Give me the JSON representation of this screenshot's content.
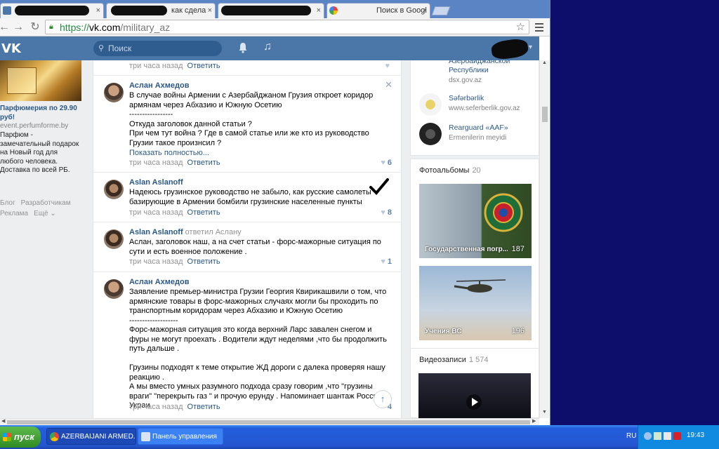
{
  "browser": {
    "tabs": [
      {
        "title": "",
        "redacted": true
      },
      {
        "title": "как сдела",
        "redacted": true
      },
      {
        "title": "",
        "redacted": true
      },
      {
        "title": "Поиск в Googl",
        "redacted": false
      }
    ],
    "url": {
      "scheme": "https://",
      "host": "vk.com",
      "path": "/military_az"
    }
  },
  "vk": {
    "logo": "VK",
    "search_placeholder": "Поиск"
  },
  "ad": {
    "title": "Парфюмерия по 29.90 руб!",
    "domain": "event.perfumforme.by",
    "text": "Парфюм - замечательный подарок на Новый год для любого человека. Доставка по всей РБ."
  },
  "footer_links": [
    "Блог",
    "Разработчикам",
    "Реклама",
    "Ещё ⌄"
  ],
  "feed": {
    "top_meta": {
      "time": "три часа назад",
      "reply": "Ответить"
    },
    "posts": [
      {
        "author": "Аслан Ахмедов",
        "author_extra": "",
        "text": "В случае войны Армении с Азербайджаном Грузия откроет коридор армянам через Абхазию и Южную Осетию\n-----------------\nОткуда заголовок данной статьи ?\nПри чем тут война ? Где в самой статье или же кто из руководство Грузии такое произнсил ?",
        "more": "Показать полностью...",
        "time": "три часа назад",
        "reply": "Ответить",
        "likes": "6"
      },
      {
        "author": "Aslan Aslanoff",
        "author_extra": "",
        "text": "Надеюсь грузинское руководство не забыло, как русские самолеты базирующие в Армении бомбили грузинские населенные пункты",
        "more": "",
        "time": "три часа назад",
        "reply": "Ответить",
        "likes": "8"
      },
      {
        "author": "Aslan Aslanoff",
        "author_extra": "ответил Аслану",
        "text": "Аслан, заголовок наш, а на счет статьи - форс-мажорные ситуация по сути и есть военное положение .",
        "more": "",
        "time": "три часа назад",
        "reply": "Ответить",
        "likes": "1"
      },
      {
        "author": "Аслан Ахмедов",
        "author_extra": "",
        "text": "Заявление премьер-министра Грузии Георгия Квирикашвили о том, что армянские товары в форс-мажорных случаях могли бы проходить по транспортным коридорам через Абхазию и Южную Осетию\n-------------------\nФорс-мажорная ситуация это когда верхний Ларс завален снегом и фуры не могут проехать . Водители ждут неделями ,что бы продолжить путь дальше .\n\nГрузины подходят к теме открытие ЖД дороги с далека проверяя нашу реакцию .\nА мы вместо умных разумного подхода сразу говорим ,что \"грузины враги\" \"перекрыть газ \" и прочую ерунду . Напоминает шантаж Россией Украи",
        "more": "",
        "time": "три часа назад",
        "reply": "Ответить",
        "likes": "4"
      }
    ]
  },
  "links": [
    {
      "title": "Азербайджанской Республики",
      "title_top": "...Азербайджанской",
      "sub": "dsx.gov.az"
    },
    {
      "title": "Səfərbərlik",
      "sub": "www.seferberlik.gov.az"
    },
    {
      "title": "Rearguard «AAF»",
      "sub": "Ermenilerin meyidi"
    }
  ],
  "photo_albums": {
    "title": "Фотоальбомы",
    "count": "20",
    "items": [
      {
        "label": "Государственная погр...",
        "count": "187"
      },
      {
        "label": "Учения ВС",
        "count": "196"
      }
    ]
  },
  "videos": {
    "title": "Видеозаписи",
    "count": "1 574"
  },
  "taskbar": {
    "start": "пуск",
    "tasks": [
      "AZERBAIJANI ARMED...",
      "Панель управления"
    ],
    "lang": "RU",
    "time": "19:43"
  }
}
